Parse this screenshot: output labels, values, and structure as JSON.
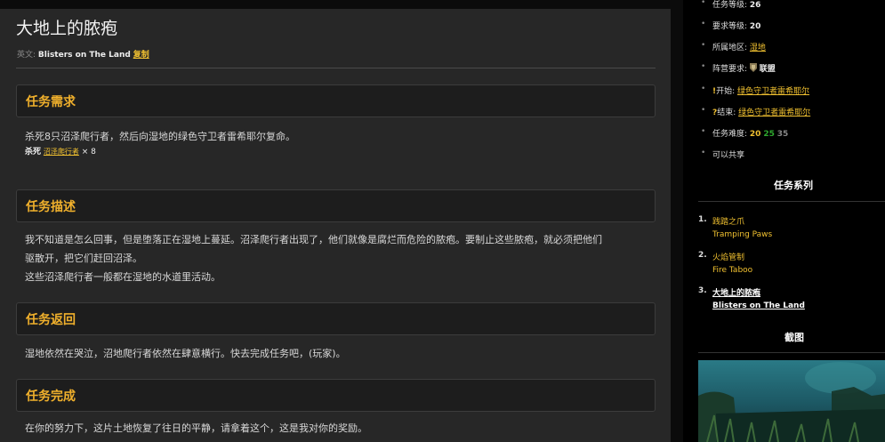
{
  "quest": {
    "title": "大地上的脓疱",
    "english_label": "英文:",
    "english_name": "Blisters on The Land",
    "copy_label": "复制"
  },
  "sections": {
    "requirements": {
      "heading": "任务需求",
      "text": "杀死8只沼泽爬行者，然后向湿地的绿色守卫者雷希耶尔复命。",
      "kill_label": "杀死",
      "kill_target": "沼泽爬行者",
      "kill_count": "× 8"
    },
    "description": {
      "heading": "任务描述",
      "line1": "我不知道是怎么回事，但是堕落正在湿地上蔓延。沼泽爬行者出现了，他们就像是腐烂而危险的脓疱。要制止这些脓疱，就必须把他们",
      "line2": "驱散开，把它们赶回沼泽。",
      "line3": "这些沼泽爬行者一般都在湿地的水道里活动。"
    },
    "return": {
      "heading": "任务返回",
      "text": "湿地依然在哭泣，沼地爬行者依然在肆意横行。快去完成任务吧，(玩家)。"
    },
    "complete": {
      "heading": "任务完成",
      "text": "在你的努力下，这片土地恢复了往日的平静，请拿着这个，这是我对你的奖励。"
    }
  },
  "sidebar": {
    "info": [
      {
        "label": "任务等级:",
        "value": "26"
      },
      {
        "label": "要求等级:",
        "value": "20"
      },
      {
        "label": "所属地区:",
        "value": "湿地"
      },
      {
        "label": "阵营要求:",
        "value": "联盟"
      },
      {
        "label": "开始:",
        "value": "绿色守卫者雷希耶尔"
      },
      {
        "label": "结束:",
        "value": "绿色守卫者雷希耶尔"
      },
      {
        "label": "任务难度:",
        "values": [
          "20",
          "25",
          "35"
        ]
      },
      {
        "label": "可以共享"
      }
    ],
    "bullet": "•",
    "start_icon": "!",
    "end_icon": "?",
    "faction_icon": "alliance-shield-icon",
    "series_heading": "任务系列",
    "series": [
      {
        "num": "1.",
        "zh": "践踏之爪",
        "en": "Tramping Paws"
      },
      {
        "num": "2.",
        "zh": "火焰管制",
        "en": "Fire Taboo"
      },
      {
        "num": "3.",
        "zh": "大地上的脓疱",
        "en": "Blisters on The Land"
      }
    ],
    "screenshot_heading": "截图"
  }
}
